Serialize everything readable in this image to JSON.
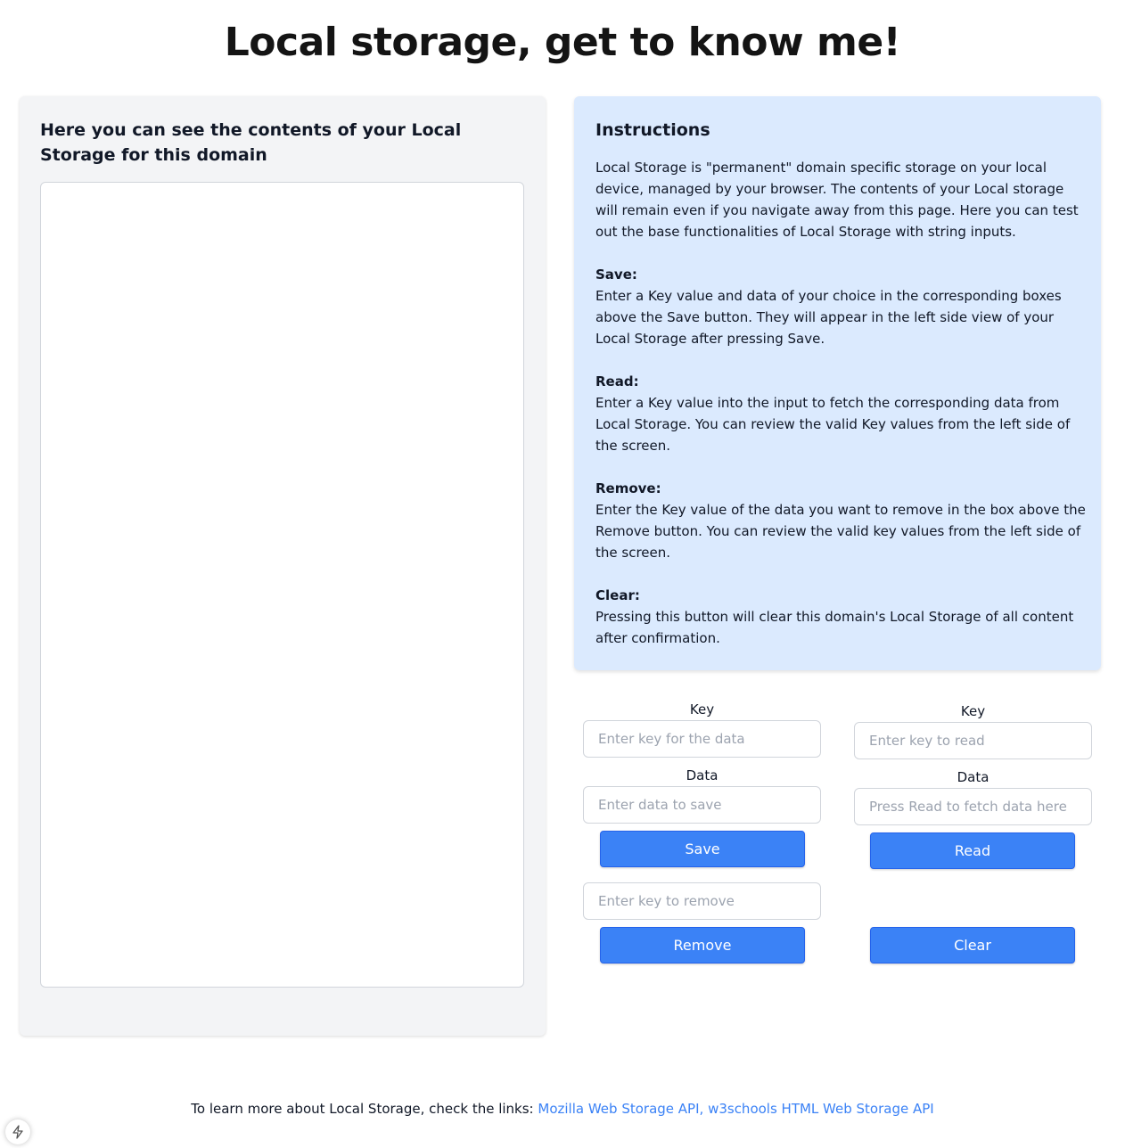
{
  "page": {
    "title": "Local storage, get to know me!"
  },
  "storage_view": {
    "heading": "Here you can see the contents of your Local Storage for this domain"
  },
  "instructions": {
    "title": "Instructions",
    "intro": "Local Storage is \"permanent\" domain specific storage on your local device, managed by your browser. The contents of your Local storage will remain even if you navigate away from this page. Here you can test out the base functionalities of Local Storage with string inputs.",
    "sections": [
      {
        "title": "Save:",
        "text": "Enter a Key value and data of your choice in the corresponding boxes above the Save button. They will appear in the left side view of your Local Storage after pressing Save."
      },
      {
        "title": "Read:",
        "text": "Enter a Key value into the input to fetch the corresponding data from Local Storage. You can review the valid Key values from the left side of the screen."
      },
      {
        "title": "Remove:",
        "text": "Enter the Key value of the data you want to remove in the box above the Remove button. You can review the valid key values from the left side of the screen."
      },
      {
        "title": "Clear:",
        "text": "Pressing this button will clear this domain's Local Storage of all content after confirmation."
      }
    ]
  },
  "save_form": {
    "key_label": "Key",
    "key_placeholder": "Enter key for the data",
    "data_label": "Data",
    "data_placeholder": "Enter data to save",
    "button_label": "Save"
  },
  "read_form": {
    "key_label": "Key",
    "key_placeholder": "Enter key to read",
    "data_label": "Data",
    "data_placeholder": "Press Read to fetch data here",
    "button_label": "Read"
  },
  "remove_form": {
    "key_placeholder": "Enter key to remove",
    "button_label": "Remove"
  },
  "clear": {
    "button_label": "Clear"
  },
  "footer": {
    "text": "To learn more about Local Storage, check the links: ",
    "link1": "Mozilla Web Storage API,",
    "link2": "w3schools HTML Web Storage API"
  },
  "badge": {
    "icon": "lightning-bolt-icon"
  }
}
